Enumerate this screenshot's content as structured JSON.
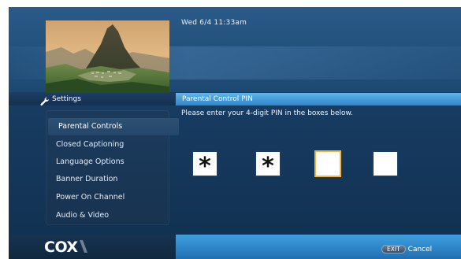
{
  "header": {
    "datetime": "Wed 6/4  11:33am"
  },
  "sidebar": {
    "title": "Settings",
    "items": [
      {
        "label": "Parental Controls",
        "selected": true
      },
      {
        "label": "Closed Captioning"
      },
      {
        "label": "Language Options"
      },
      {
        "label": "Banner Duration"
      },
      {
        "label": "Power On Channel"
      },
      {
        "label": "Audio & Video"
      }
    ]
  },
  "panel": {
    "title": "Parental Control PIN",
    "instruction": "Please enter your 4-digit PIN in the boxes below.",
    "pin": [
      {
        "value": "*"
      },
      {
        "value": "*"
      },
      {
        "value": "",
        "active": true
      },
      {
        "value": ""
      }
    ]
  },
  "footer": {
    "logo": "COX",
    "exit_key": "EXIT",
    "cancel_label": "Cancel"
  },
  "colors": {
    "accent_blue": "#3fa0e0",
    "active_pin_border": "#f2b53a",
    "background": "#1f4670"
  },
  "icons": {
    "settings": "wrench-icon",
    "logo": "cox-logo"
  }
}
